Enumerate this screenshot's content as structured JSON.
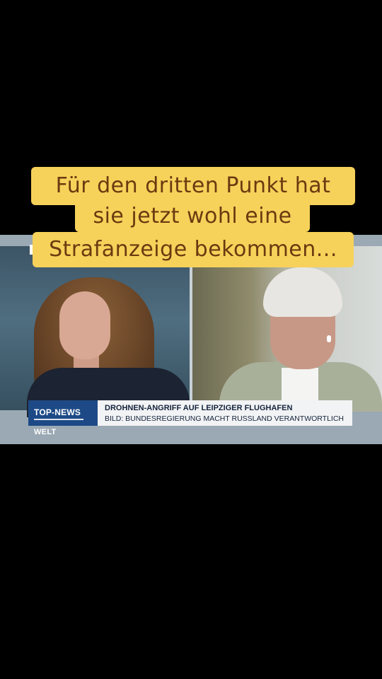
{
  "caption": {
    "line1": "Für den dritten Punkt hat",
    "line2": "sie jetzt wohl eine",
    "line3": "Strafanzeige bekommen..."
  },
  "ticker": {
    "tag": "TOP-NEWS",
    "headline": "DROHNEN-ANGRIFF AUF LEIPZIGER FLUGHAFEN",
    "subline": "BILD: BUNDESREGIERUNG MACHT RUSSLAND VERANTWORTLICH"
  },
  "channel_logo": "WELT",
  "colors": {
    "caption_bg": "#f6d25a",
    "caption_text": "#6b3a10",
    "ticker_tag": "#1d4a86"
  }
}
